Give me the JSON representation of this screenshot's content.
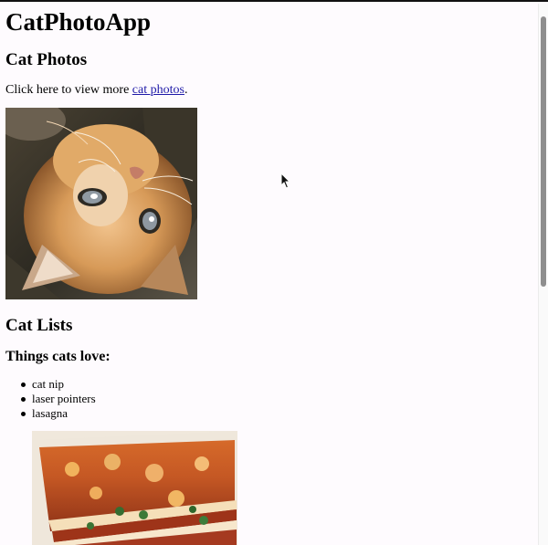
{
  "page": {
    "title": "CatPhotoApp",
    "section_photos": "Cat Photos",
    "link_intro": "Click here to view more ",
    "link_text": "cat photos",
    "link_suffix": ".",
    "section_lists": "Cat Lists",
    "things_heading": "Things cats love:",
    "things": [
      "cat nip",
      "laser pointers",
      "lasagna"
    ]
  },
  "icons": {
    "cursor": "mouse-pointer-icon"
  },
  "colors": {
    "background": "#fefbfe",
    "link": "#1f1aa8",
    "scrollbar_thumb": "#8e8e8e"
  }
}
